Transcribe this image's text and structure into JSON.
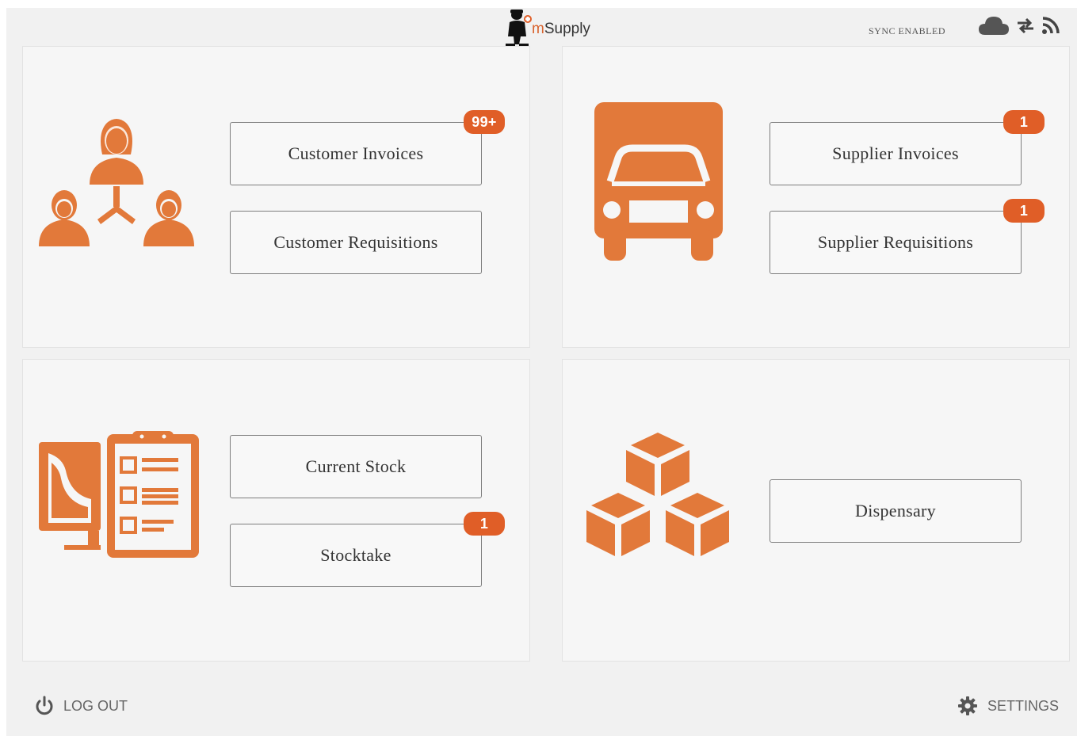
{
  "header": {
    "logo_prefix": "m",
    "logo_suffix": "Supply",
    "sync_status": "SYNC ENABLED",
    "icons": [
      "cloud-icon",
      "sync-arrows-icon",
      "rss-icon"
    ]
  },
  "panels": {
    "customer": {
      "icon": "customers-icon",
      "buttons": [
        {
          "label": "Customer Invoices",
          "badge": "99+"
        },
        {
          "label": "Customer Requisitions",
          "badge": ""
        }
      ]
    },
    "supplier": {
      "icon": "truck-icon",
      "buttons": [
        {
          "label": "Supplier Invoices",
          "badge": "1"
        },
        {
          "label": "Supplier Requisitions",
          "badge": "1"
        }
      ]
    },
    "stock": {
      "icon": "stock-clipboard-icon",
      "buttons": [
        {
          "label": "Current Stock",
          "badge": ""
        },
        {
          "label": "Stocktake",
          "badge": "1"
        }
      ]
    },
    "dispensary": {
      "icon": "boxes-icon",
      "buttons": [
        {
          "label": "Dispensary",
          "badge": ""
        }
      ]
    }
  },
  "footer": {
    "logout_label": "LOG OUT",
    "settings_label": "SETTINGS"
  },
  "colors": {
    "accent": "#e2793a",
    "badge": "#e05e27",
    "background": "#f1f1f1",
    "panel": "#f6f6f6"
  }
}
